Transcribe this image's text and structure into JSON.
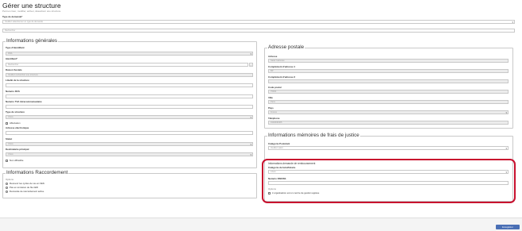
{
  "page": {
    "title": "Gérer une structure",
    "subtitle": "Permet créer, modifier, activer, désactiver une structure"
  },
  "top": {
    "type_label": "Type de demande*",
    "type_value": "Veuillez sélectionner un type de demande",
    "search_placeholder": "Rechercher"
  },
  "general": {
    "legend": "Informations générales",
    "type_id_label": "Type d'identifiant",
    "type_id_value": "RNA",
    "identifiant_label": "Identifiant*",
    "identifiant_value": "Rechercher",
    "raison_label": "Raison Sociale",
    "raison_value": "Veuillez rechercher une structure",
    "libelle_label": "Libellé de la structure",
    "rcs_label": "Numéro RCS",
    "tva_label": "Numéro TVA intracommunautaire",
    "type_struct_label": "Type de structure",
    "type_struct_value": "Choix",
    "affectation_label": "Affectation",
    "adresse_elec_label": "Adresse électronique",
    "statut_label": "Statut",
    "statut_value": "Choix",
    "destinataire_label": "Destinataire principal",
    "destinataire_value": "Choix",
    "non_diffusible_label": "Non diffusible"
  },
  "raccordement": {
    "legend": "Informations Raccordement",
    "options_label": "Options",
    "option1": "Recevoir les cycles de vie en FEN",
    "option2": "Pas en émission de flux EDI",
    "option3": "Demande de raccordement active"
  },
  "postale": {
    "legend": "Adresse postale",
    "adresse_label": "Adresse",
    "adresse_value": "Saisir l'adresse",
    "comp1_label": "Complément d'adresse 1",
    "comp1_value": "BP",
    "comp2_label": "Complément d'adresse 2",
    "cp_label": "Code postal",
    "cp_value": "75000",
    "ville_label": "Ville",
    "ville_value": "Paris",
    "pays_label": "Pays",
    "pays_value": "France",
    "tel_label": "Téléphone",
    "tel_value": "0102030405"
  },
  "justice": {
    "legend": "Informations mémoires de frais de justice",
    "categorie_label": "Catégorie Postulant",
    "categorie_value": "Veuillez saisir",
    "rembours_header": "Informations demande de remboursement",
    "benef_label": "Catégorie de bénéficiaire",
    "benef_value": "Choix",
    "finess_label": "Numéro FINOSS",
    "options_label": "Options",
    "option_gestion": "L'organisation est un centre de gestion agréée"
  },
  "footer": {
    "save_label": "Enregistrer"
  }
}
